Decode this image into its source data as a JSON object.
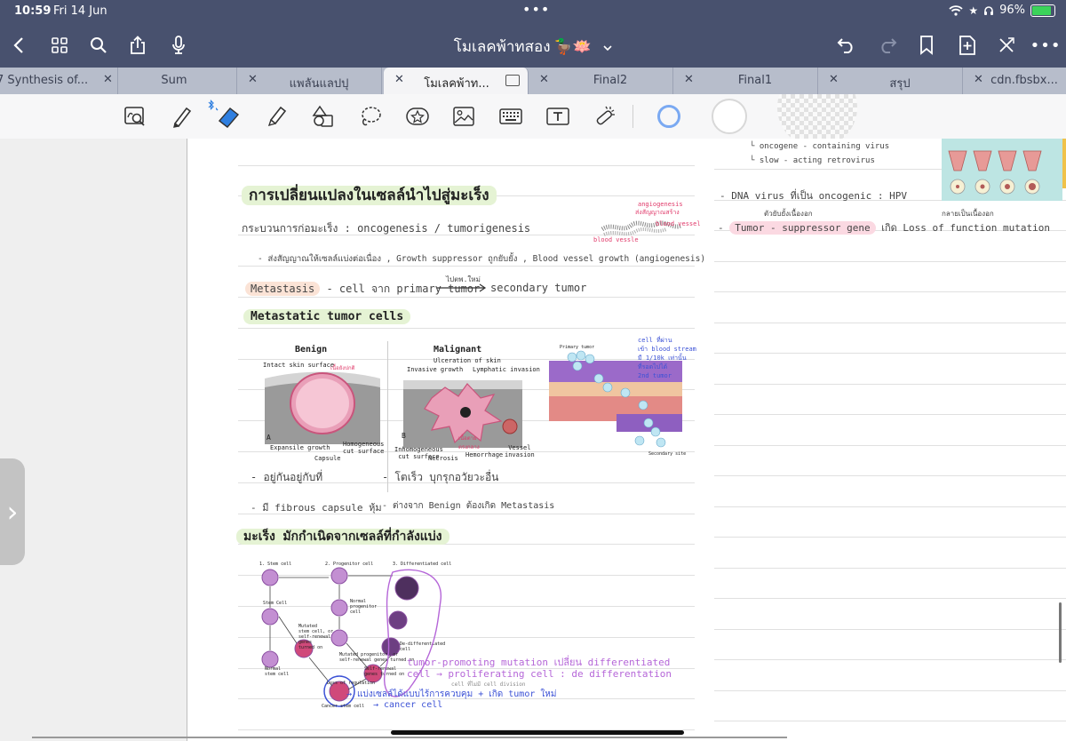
{
  "status": {
    "time": "10:59",
    "date": "Fri 14 Jun",
    "battery": "96%",
    "battery_level": 0.96
  },
  "header": {
    "title": "โมเลคพ้าทสอง",
    "title_emoji": "🦆🪷"
  },
  "tabs": [
    {
      "label": "7 Synthesis of...",
      "active": false
    },
    {
      "label": "Sum",
      "active": false
    },
    {
      "label": "แพลันแลปปุ",
      "active": false
    },
    {
      "label": "โมเลคพ้าท...",
      "active": true
    },
    {
      "label": "Final2",
      "active": false
    },
    {
      "label": "Final1",
      "active": false
    },
    {
      "label": "สรุป",
      "active": false
    },
    {
      "label": "cdn.fbsbx...",
      "active": false
    }
  ],
  "colors": {
    "nav": "#48516e",
    "tabs": "#b7bdcb",
    "accent_ring": "#7aa9f2",
    "green_hl": "#e5f3d4",
    "purple_ink": "#b566d8",
    "blue_ink": "#3c52d6"
  },
  "notes": {
    "h1": "การเปลี่ยนแปลงในเซลล์นำไปสู่มะเร็ง",
    "line_oncogenesis": "กระบวนการก่อมะเร็ง : oncogenesis / tumorigenesis",
    "sketch_angio": "angiogenesis",
    "sketch_angio_th": "ส่งสัญญาณสร้าง",
    "sketch_vessel": "blood vessel",
    "sketch_vessel2": "blood vessle",
    "line_signal": "- ส่งสัญญาณให้เซลล์แบ่งต่อเนื่อง , Growth suppressor ถูกยับยั้ง , Blood vessel growth (angiogenesis)",
    "metastasis_word": "Metastasis",
    "metastasis_rest": "- cell จาก primary tumor",
    "metastasis_arrow_note": "ไปตพ.ใหม่",
    "metastasis_end": "secondary tumor",
    "h2": "Metastatic tumor cells",
    "benign_title": "Benign",
    "malignant_title": "Malignant",
    "fig_intact": "Intact skin surface",
    "fig_intact_th": "เนื้อยังปกติ",
    "fig_expansile": "Expansile growth",
    "fig_capsule": "Capsule",
    "fig_homog": "Homogeneous\ncut surface",
    "fig_ulcer": "Ulceration of skin",
    "fig_invasive": "Invasive growth",
    "fig_lymph": "Lymphatic invasion",
    "fig_inhomog": "Inhomogeneous\ncut surface",
    "fig_necrosis": "Necrosis",
    "fig_hemorrhage": "Hemorrhage",
    "fig_vessel": "Vessel\ninvasion",
    "fig_deadcell": "เนื้อตาย\nตรงกลาง",
    "fig_a": "A",
    "fig_b": "B",
    "fig_primary": "Primary tumor",
    "fig_secondary": "Secondary site",
    "fig_blood_note": "cell ที่ผ่าน\nเข้า blood stream\nมี 1/10k เท่านั้น\nที่รอดไปได้\n2nd tumor",
    "line_benign1": "- อยู่กันอยู่กับที่",
    "line_malig1": "- โตเร็ว  บุกรุกอวัยวะอื่น",
    "line_benign2": "- มี fibrous capsule หุ้ม",
    "line_malig2": "- ต่างจาก Benign ต้องเกิด Metastasis",
    "h3": "มะเร็ง มักกำเนิดจากเซลล์ที่กำลังแบ่ง",
    "stem1": "1. Stem cell",
    "stem2": "2. Progenitor cell",
    "stem3": "3. Differentiated cell",
    "stem_stemcell": "Stem Cell",
    "stem_normal_prog": "Normal\nprogenitor\ncell",
    "stem_mutated": "Mutated\nstem cell, or\nself-renewal\ngenes\nturned on",
    "stem_mutprog": "Mutated progenitor, or\nself-renewal genes turned on",
    "stem_dediff": "De-differentiated\ncell",
    "stem_normal_stem": "Normal\nstem cell",
    "stem_loss": "Loss of regulation",
    "stem_selfrenew": "Self-renewal\ngenes turned on",
    "stem_cancer": "Cancer stem cell",
    "purple1": "tumor-promoting mutation เปลี่ยน differentiated",
    "purple2": "cell → proliferating cell : de differentation",
    "purple_sub": "cell ที่ไม่มี cell division",
    "blue1": "→ แบ่งเซลล์ได้แบบไร้การควบคุม + เกิด tumor ใหม่",
    "blue2": "→ cancer cell",
    "r_virus1": "oncogene - containing virus",
    "r_virus2": "slow - acting retrovirus",
    "r_dna": "-  DNA virus ที่เป็น oncogenic  : HPV",
    "r_note_a": "ตัวยับยั้งเนื้องอก",
    "r_note_b": "กลายเป็นเนื้องอก",
    "r_tsg": "Tumor - suppressor gene",
    "r_loss": "เกิด Loss of function mutation"
  }
}
